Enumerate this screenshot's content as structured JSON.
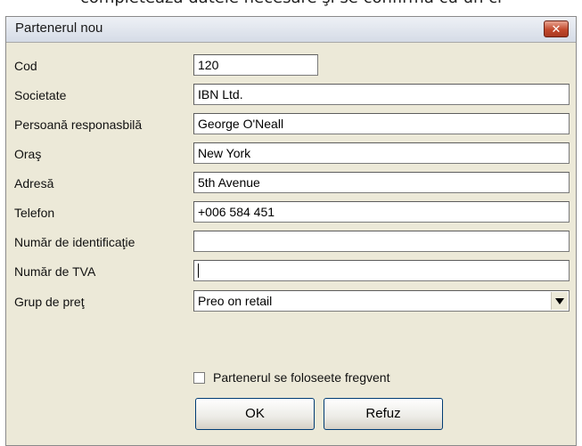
{
  "background_caption": "completează datele necesare şi se confirmă cu un cl",
  "dialog": {
    "title": "Partenerul nou",
    "close_symbol": "✕"
  },
  "fields": [
    {
      "label": "Cod",
      "value": "120"
    },
    {
      "label": "Societate",
      "value": "IBN Ltd."
    },
    {
      "label": "Persoană responasbilă",
      "value": "George O'Neall"
    },
    {
      "label": "Oraş",
      "value": "New York"
    },
    {
      "label": "Adresă",
      "value": "5th Avenue"
    },
    {
      "label": "Telefon",
      "value": "+006 584 451"
    },
    {
      "label": "Număr de identificaţie",
      "value": ""
    },
    {
      "label": "Număr de TVA",
      "value": ""
    }
  ],
  "price_group": {
    "label": "Grup de preţ",
    "selected": "Preo on retail"
  },
  "frequent_checkbox": {
    "label": "Partenerul se foloseete fregvent",
    "checked": false
  },
  "buttons": {
    "ok": "OK",
    "cancel": "Refuz"
  },
  "colors": {
    "dialog_bg": "#ece9d8",
    "close_red": "#c3492c",
    "button_border": "#003c74"
  }
}
